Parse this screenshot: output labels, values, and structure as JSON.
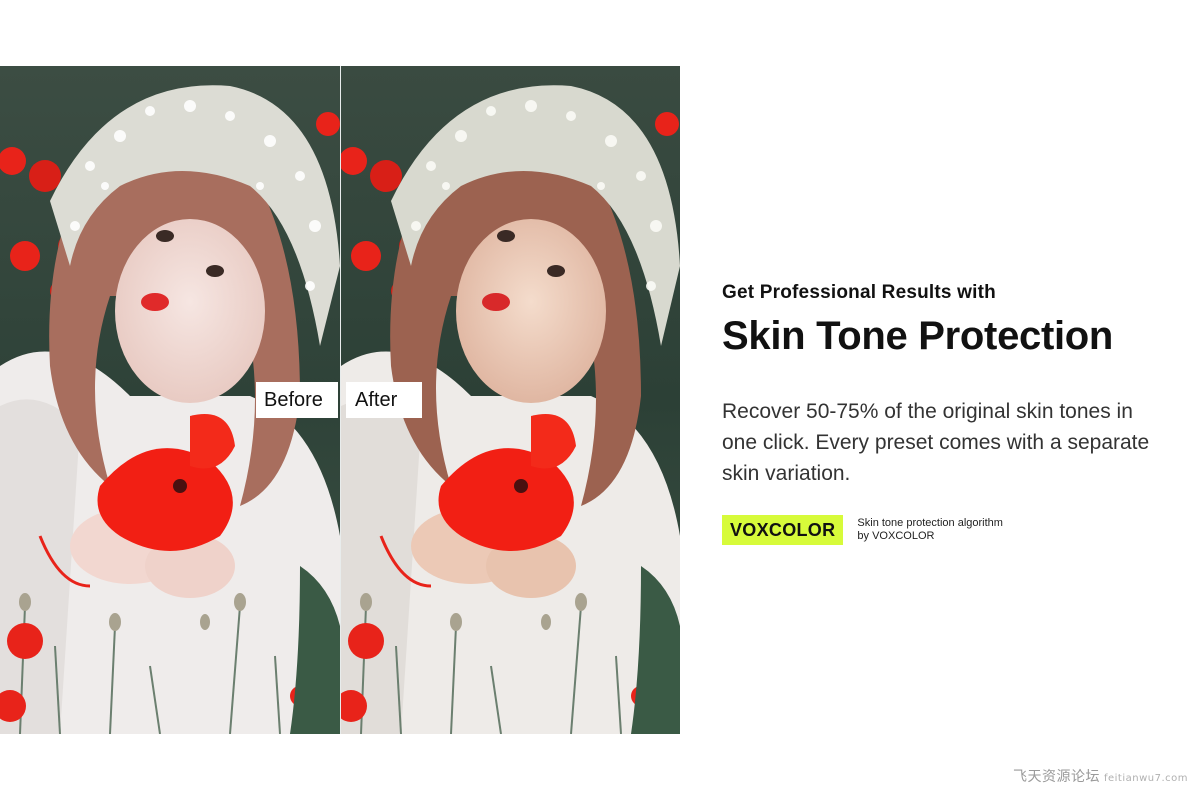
{
  "comparison": {
    "before_label": "Before",
    "after_label": "After"
  },
  "promo": {
    "kicker": "Get Professional Results with",
    "headline": "Skin Tone Protection",
    "body": "Recover 50-75% of the original skin tones in one click.  Every preset comes with a separate skin variation.",
    "brand_badge": "VOXCOLOR",
    "brand_note": "Skin tone protection algorithm by VOXCOLOR"
  },
  "watermark": {
    "text": "飞天资源论坛",
    "site": "feitianwu7.com"
  },
  "colors": {
    "badge": "#d7fb3a",
    "poppy": "#e8231a",
    "foliage": "#2f4a3e"
  }
}
